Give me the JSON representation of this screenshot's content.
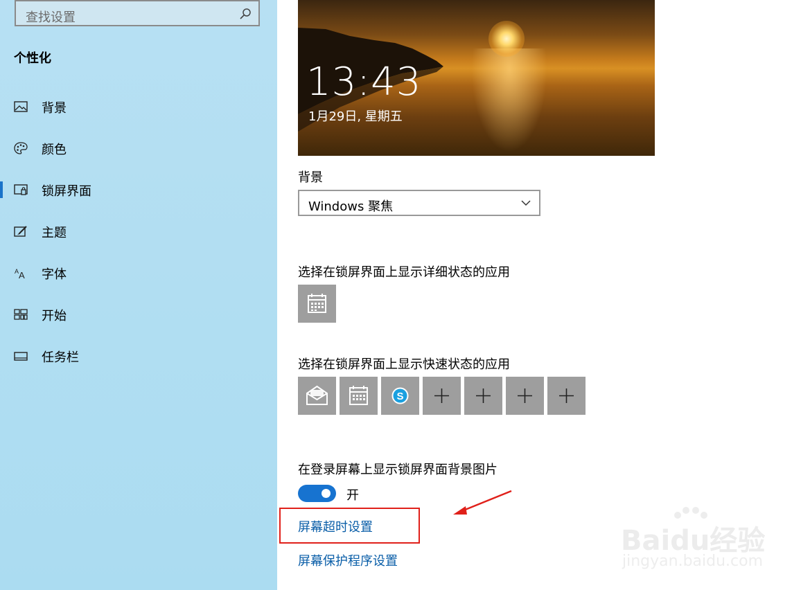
{
  "sidebar": {
    "search_placeholder": "查找设置",
    "section_title": "个性化",
    "items": [
      {
        "label": "背景",
        "icon": "picture-icon"
      },
      {
        "label": "颜色",
        "icon": "palette-icon"
      },
      {
        "label": "锁屏界面",
        "icon": "lock-screen-icon",
        "selected": true
      },
      {
        "label": "主题",
        "icon": "theme-brush-icon"
      },
      {
        "label": "字体",
        "icon": "font-icon"
      },
      {
        "label": "开始",
        "icon": "start-tiles-icon"
      },
      {
        "label": "任务栏",
        "icon": "taskbar-icon"
      }
    ]
  },
  "preview": {
    "time": "13:43",
    "date": "1月29日, 星期五"
  },
  "background": {
    "label": "背景",
    "selected": "Windows 聚焦"
  },
  "detailed_status": {
    "label": "选择在锁屏界面上显示详细状态的应用",
    "app_icon": "calendar-icon"
  },
  "quick_status": {
    "label": "选择在锁屏界面上显示快速状态的应用",
    "apps": [
      "mail-icon",
      "calendar-icon",
      "skype-icon",
      "plus-icon",
      "plus-icon",
      "plus-icon",
      "plus-icon"
    ]
  },
  "show_bg_on_signin": {
    "label": "在登录屏幕上显示锁屏界面背景图片",
    "state": "开",
    "on": true
  },
  "links": {
    "screen_timeout": "屏幕超时设置",
    "screen_saver": "屏幕保护程序设置"
  },
  "watermark": {
    "brand": "Baidu经验",
    "site": "jingyan.baidu.com"
  },
  "colors": {
    "sidebar_bg": "#b3dff2",
    "accent": "#1773d0",
    "link": "#0a5ea8",
    "highlight_box": "#e0201a",
    "tile_bg": "#9e9e9e"
  }
}
